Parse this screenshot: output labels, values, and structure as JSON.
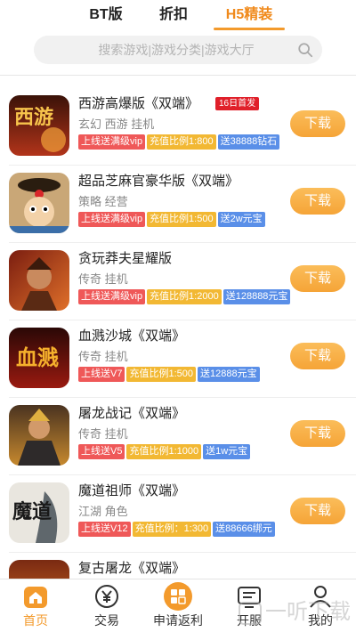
{
  "top_tabs": [
    {
      "label": "BT版"
    },
    {
      "label": "折扣"
    },
    {
      "label": "H5精装"
    }
  ],
  "search": {
    "placeholder": "搜索游戏|游戏分类|游戏大厅"
  },
  "games": [
    {
      "name": "西游高爆版《双端》",
      "badge": "16日首发",
      "genre": "玄幻 西游 挂机",
      "tags": [
        "上线送满级vip",
        "充值比例1:800",
        "送38888钻石"
      ],
      "download": "下载"
    },
    {
      "name": "超品芝麻官豪华版《双端》",
      "genre": "策略 经营",
      "tags": [
        "上线送满级vip",
        "充值比例1:500",
        "送2w元宝"
      ],
      "download": "下载"
    },
    {
      "name": "贪玩莽夫星耀版",
      "genre": "传奇 挂机",
      "tags": [
        "上线送满级vip",
        "充值比例1:2000",
        "送128888元宝"
      ],
      "download": "下载"
    },
    {
      "name": "血溅沙城《双端》",
      "genre": "传奇 挂机",
      "tags": [
        "上线送V7",
        "充值比例1:500",
        "送12888元宝"
      ],
      "download": "下载"
    },
    {
      "name": "屠龙战记《双端》",
      "genre": "传奇 挂机",
      "tags": [
        "上线送V5",
        "充值比例1:1000",
        "送1w元宝"
      ],
      "download": "下载"
    },
    {
      "name": "魔道祖师《双端》",
      "genre": "江湖 角色",
      "tags": [
        "上线送V12",
        "充值比例：1:300",
        "送88666绑元"
      ],
      "download": "下载"
    },
    {
      "name": "复古屠龙《双端》"
    }
  ],
  "thumb_text": {
    "g0": "西游",
    "g3": "血溅",
    "g5": "魔道"
  },
  "bottom_nav": [
    {
      "label": "首页",
      "icon": "home-icon"
    },
    {
      "label": "交易",
      "icon": "yen-icon"
    },
    {
      "label": "申请返利",
      "icon": "rebate-icon"
    },
    {
      "label": "开服",
      "icon": "server-icon"
    },
    {
      "label": "我的",
      "icon": "user-icon"
    }
  ],
  "watermark": {
    "text": "一听下载"
  },
  "colors": {
    "accent": "#f39a2c",
    "badge": "#e0202a",
    "tag_red": "#ef5858",
    "tag_yellow": "#f2b833",
    "tag_blue": "#5a8fe8"
  }
}
